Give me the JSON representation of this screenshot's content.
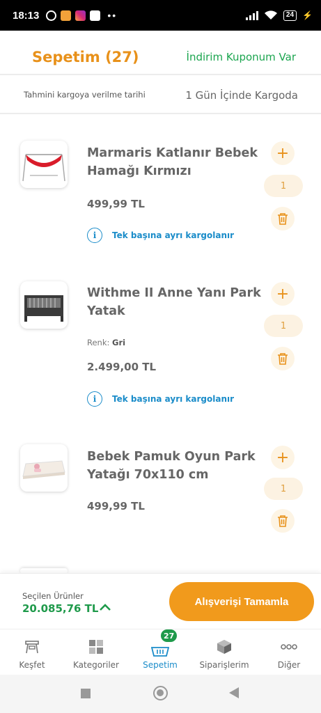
{
  "status_bar": {
    "time": "18:13",
    "battery": "24",
    "dots": "••"
  },
  "header": {
    "title": "Sepetim (27)",
    "coupon_link": "İndirim Kuponum Var"
  },
  "shipping": {
    "label": "Tahmini kargoya verilme tarihi",
    "value": "1 Gün İçinde Kargoda"
  },
  "items": [
    {
      "name": "Marmaris Katlanır Bebek Hamağı Kırmızı",
      "price": "499,99 TL",
      "quantity": "1",
      "shipping_note": "Tek başına ayrı kargolanır",
      "thumbnail": "red-baby-hammock"
    },
    {
      "name": "Withme II Anne Yanı Park Yatak",
      "variant_label": "Renk:",
      "variant_value": "Gri",
      "price": "2.499,00 TL",
      "quantity": "1",
      "shipping_note": "Tek başına ayrı kargolanır",
      "thumbnail": "grey-park-bed"
    },
    {
      "name": "Bebek Pamuk Oyun Park Yatağı 70x110 cm",
      "price": "499,99 TL",
      "quantity": "1",
      "thumbnail": "cotton-mattress"
    }
  ],
  "summary": {
    "label": "Seçilen Ürünler",
    "total": "20.085,76 TL",
    "checkout_button": "Alışverişi Tamamla"
  },
  "tabs": [
    {
      "label": "Keşfet",
      "icon": "discover-icon"
    },
    {
      "label": "Kategoriler",
      "icon": "categories-icon"
    },
    {
      "label": "Sepetim",
      "icon": "basket-icon",
      "badge": "27",
      "active": true
    },
    {
      "label": "Siparişlerim",
      "icon": "orders-box-icon"
    },
    {
      "label": "Diğer",
      "icon": "more-dots-icon"
    }
  ],
  "colors": {
    "accent": "#e8911a",
    "green": "#1f9a4b",
    "link_blue": "#1a8cc9"
  }
}
